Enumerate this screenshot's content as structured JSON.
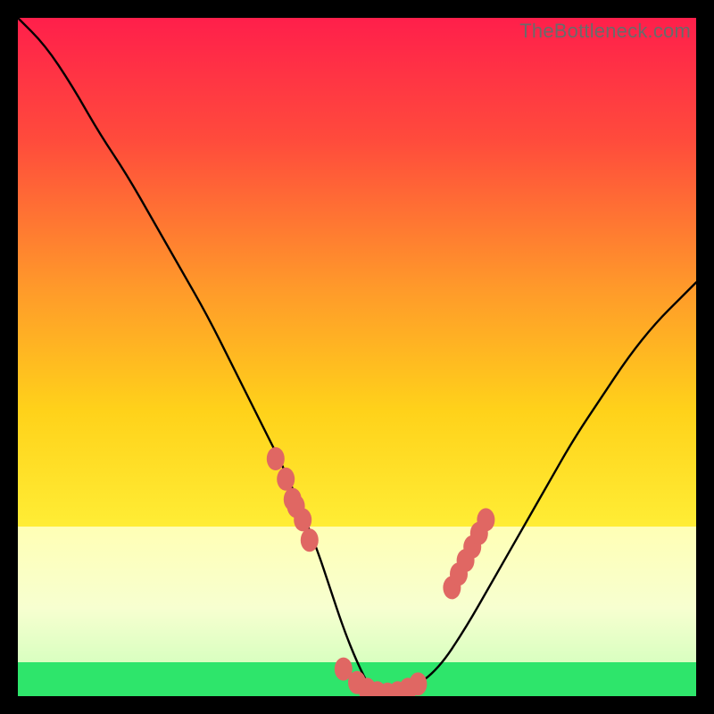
{
  "watermark": {
    "text": "TheBottleneck.com"
  },
  "colors": {
    "background": "#000000",
    "curve": "#000000",
    "markers": "#e06763",
    "green_band": "#2ee56b",
    "gradient_top": "#ff1f4b",
    "gradient_mid_upper": "#ff7a2f",
    "gradient_mid": "#ffd21a",
    "gradient_mid_lower": "#fff83a",
    "gradient_bottom": "#2ee56b"
  },
  "chart_data": {
    "type": "line",
    "title": "",
    "xlabel": "",
    "ylabel": "",
    "xlim": [
      0,
      100
    ],
    "ylim": [
      0,
      100
    ],
    "grid": false,
    "legend": false,
    "green_band_y": [
      0,
      5
    ],
    "pale_band_y": [
      5,
      25
    ],
    "series": [
      {
        "name": "bottleneck-curve",
        "x": [
          0,
          4,
          8,
          12,
          16,
          20,
          24,
          28,
          32,
          36,
          40,
          44,
          46,
          48,
          50,
          52,
          54,
          56,
          58,
          62,
          66,
          70,
          74,
          78,
          82,
          86,
          90,
          94,
          98,
          100
        ],
        "y": [
          100,
          96,
          90,
          83,
          77,
          70,
          63,
          56,
          48,
          40,
          32,
          22,
          16,
          10,
          5,
          1,
          0,
          0,
          1,
          4,
          10,
          17,
          24,
          31,
          38,
          44,
          50,
          55,
          59,
          61
        ]
      }
    ],
    "markers": [
      {
        "name": "left-cluster",
        "x": [
          38,
          39.5,
          40.5,
          41,
          42,
          43
        ],
        "y": [
          35,
          32,
          29,
          28,
          26,
          23
        ]
      },
      {
        "name": "valley-cluster",
        "x": [
          48,
          50,
          51.5,
          53,
          54.5,
          56,
          57.5,
          59
        ],
        "y": [
          4,
          2,
          1,
          0.5,
          0.3,
          0.5,
          1,
          1.8
        ]
      },
      {
        "name": "right-cluster",
        "x": [
          64,
          65,
          66,
          67,
          68,
          69
        ],
        "y": [
          16,
          18,
          20,
          22,
          24,
          26
        ]
      }
    ]
  }
}
